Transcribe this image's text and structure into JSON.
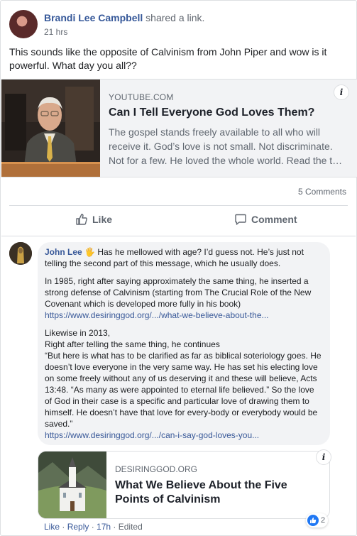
{
  "post": {
    "author": "Brandi Lee Campbell",
    "action": " shared a link.",
    "time": "21 hrs",
    "text": "This sounds like the opposite of Calvinism from John Piper and wow is it powerful. What day you all??",
    "preview": {
      "domain": "YOUTUBE.COM",
      "title": "Can I Tell Everyone God Loves Them?",
      "description": "The gospel stands freely available to all who will receive it. God’s love is not small. Not discriminate. Not for a few. He loved the whole world. Read the t…",
      "info_icon": "i"
    },
    "comments_count": "5 Comments",
    "actions": {
      "like": "Like",
      "comment": "Comment"
    }
  },
  "comment": {
    "author": "John Lee",
    "wave_icon": "🖐",
    "p1": "Has he mellowed with age? I’d guess not. He’s just not telling the second part of this message, which he usually does.",
    "p2": "In 1985, right after saying approximately the same thing, he inserted a strong defense of Calvinism (starting from The Crucial Role of the New Covenant which is developed more fully in his book)",
    "link1": "https://www.desiringgod.org/.../what-we-believe-about-the...",
    "p3_line1": "Likewise in 2013,",
    "p3_line2": "Right after telling the same thing, he continues",
    "p3_quote": "“But here is what has to be clarified as far as biblical soteriology goes. He doesn’t love everyone in the very same way. He has set his electing love on some freely without any of us deserving it and these will believe, Acts 13:48. “As many as were appointed to eternal life believed.” So the love of God in their case is a specific and particular love of drawing them to himself. He doesn’t have that love for every-body or everybody would be saved.”",
    "link2": "https://www.desiringgod.org/.../can-i-say-god-loves-you...",
    "attachment": {
      "domain": "DESIRINGGOD.ORG",
      "title": "What We Believe About the Five Points of Calvinism",
      "info_icon": "i"
    },
    "meta": {
      "like": "Like",
      "sep": " · ",
      "reply": "Reply",
      "time": "17h",
      "edited": "Edited"
    },
    "reactions": "2"
  },
  "colors": {
    "link": "#385898",
    "name": "#365899",
    "muted": "#606770",
    "bubble": "#f2f3f5",
    "like_blue": "#2078f4"
  }
}
